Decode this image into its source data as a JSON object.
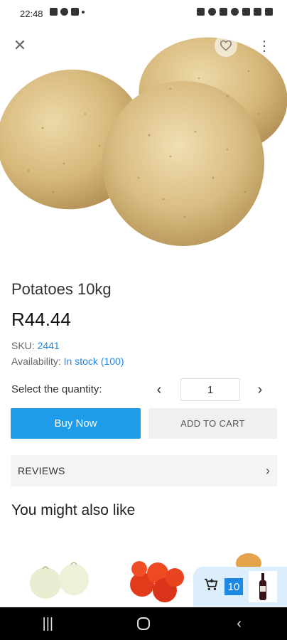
{
  "status_bar": {
    "time": "22:48"
  },
  "product": {
    "title": "Potatoes 10kg",
    "price": "R44.44",
    "sku_label": "SKU:",
    "sku_value": "2441",
    "availability_label": "Availability:",
    "availability_value": "In stock",
    "availability_count": "(100)"
  },
  "quantity": {
    "label": "Select the quantity:",
    "value": "1"
  },
  "actions": {
    "buy_now": "Buy Now",
    "add_to_cart": "ADD TO CART"
  },
  "reviews": {
    "label": "REVIEWS"
  },
  "related": {
    "title": "You might also like"
  },
  "floating_cart": {
    "count": "10"
  },
  "colors": {
    "accent": "#1e9be9",
    "link": "#1e88e5",
    "cart_bg": "#dceefc"
  }
}
